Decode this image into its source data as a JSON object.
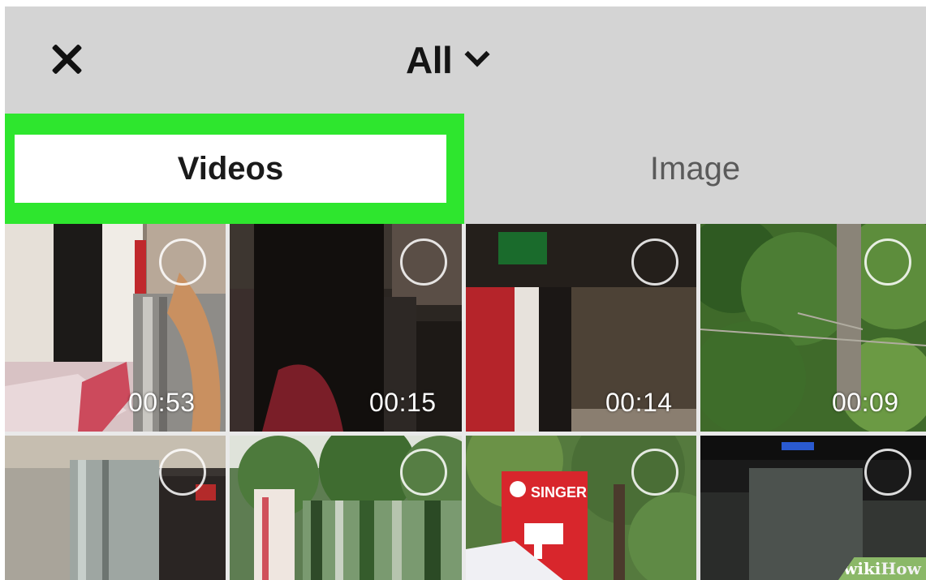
{
  "header": {
    "album_label": "All",
    "close_icon": "close-icon",
    "dropdown_icon": "chevron-down-icon"
  },
  "tabs": [
    {
      "label": "Videos",
      "selected": true
    },
    {
      "label": "Image",
      "selected": false
    }
  ],
  "colors": {
    "header_bg": "#d4d4d4",
    "highlight": "#2ee62e",
    "selected_tab_bg": "#ffffff"
  },
  "grid": {
    "rows": [
      [
        {
          "duration": "00:53"
        },
        {
          "duration": "00:15"
        },
        {
          "duration": "00:14"
        },
        {
          "duration": "00:09"
        }
      ],
      [
        {
          "duration": ""
        },
        {
          "duration": ""
        },
        {
          "duration": ""
        },
        {
          "duration": ""
        }
      ]
    ]
  },
  "watermark": {
    "wiki": "wiki",
    "how": "How"
  }
}
